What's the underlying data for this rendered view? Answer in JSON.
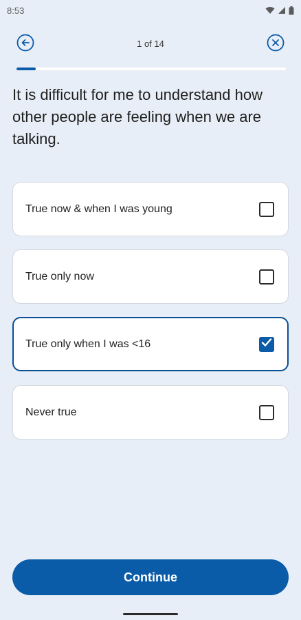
{
  "status_bar": {
    "time": "8:53",
    "icons": [
      "wifi-icon",
      "signal-icon",
      "battery-icon"
    ]
  },
  "header": {
    "back_icon": "arrow-left-circle-icon",
    "progress_text": "1 of 14",
    "close_icon": "close-circle-icon"
  },
  "progress": {
    "current": 1,
    "total": 14,
    "fraction": 0.071
  },
  "question": {
    "text": "It is difficult for me to understand how other people are feeling when we are talking."
  },
  "options": [
    {
      "label": "True now & when I was young",
      "checked": false
    },
    {
      "label": "True only now",
      "checked": false
    },
    {
      "label": "True only when I was <16",
      "checked": true
    },
    {
      "label": "Never true",
      "checked": false
    }
  ],
  "continue_button": {
    "label": "Continue"
  },
  "colors": {
    "accent": "#0a5ba8",
    "background": "#e8eef7",
    "card": "#ffffff"
  }
}
